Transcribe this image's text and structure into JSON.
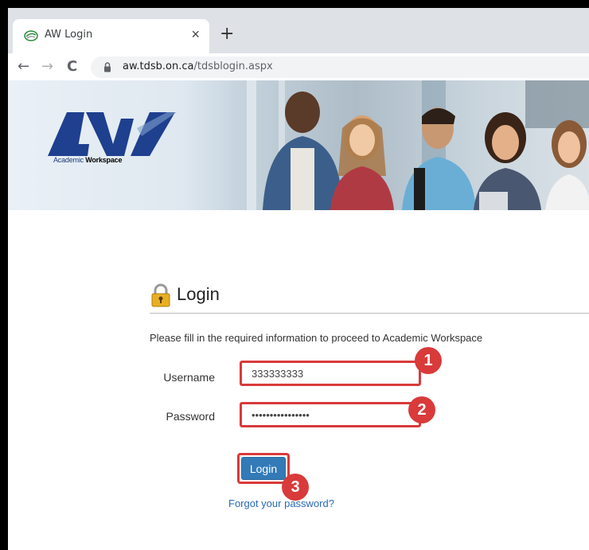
{
  "browser": {
    "tab_title": "AW Login",
    "tab_close": "×",
    "new_tab": "+",
    "url_host": "aw.tdsb.on.ca",
    "url_path": "/tdsblogin.aspx",
    "back": "←",
    "forward": "→",
    "reload": "C"
  },
  "banner": {
    "logo_text": "AW",
    "logo_sub_prefix": "Academic ",
    "logo_sub_bold": "Workspace"
  },
  "login": {
    "title": "Login",
    "intro": "Please fill in the required information to proceed to Academic Workspace",
    "username_label": "Username",
    "username_value": "333333333",
    "password_label": "Password",
    "password_value": "••••••••••••••••",
    "button_label": "Login",
    "forgot_link": "Forgot your password?"
  },
  "annotations": [
    "1",
    "2",
    "3"
  ],
  "colors": {
    "highlight": "#d93a3a",
    "button": "#337ab7",
    "link": "#2a6ab7"
  }
}
